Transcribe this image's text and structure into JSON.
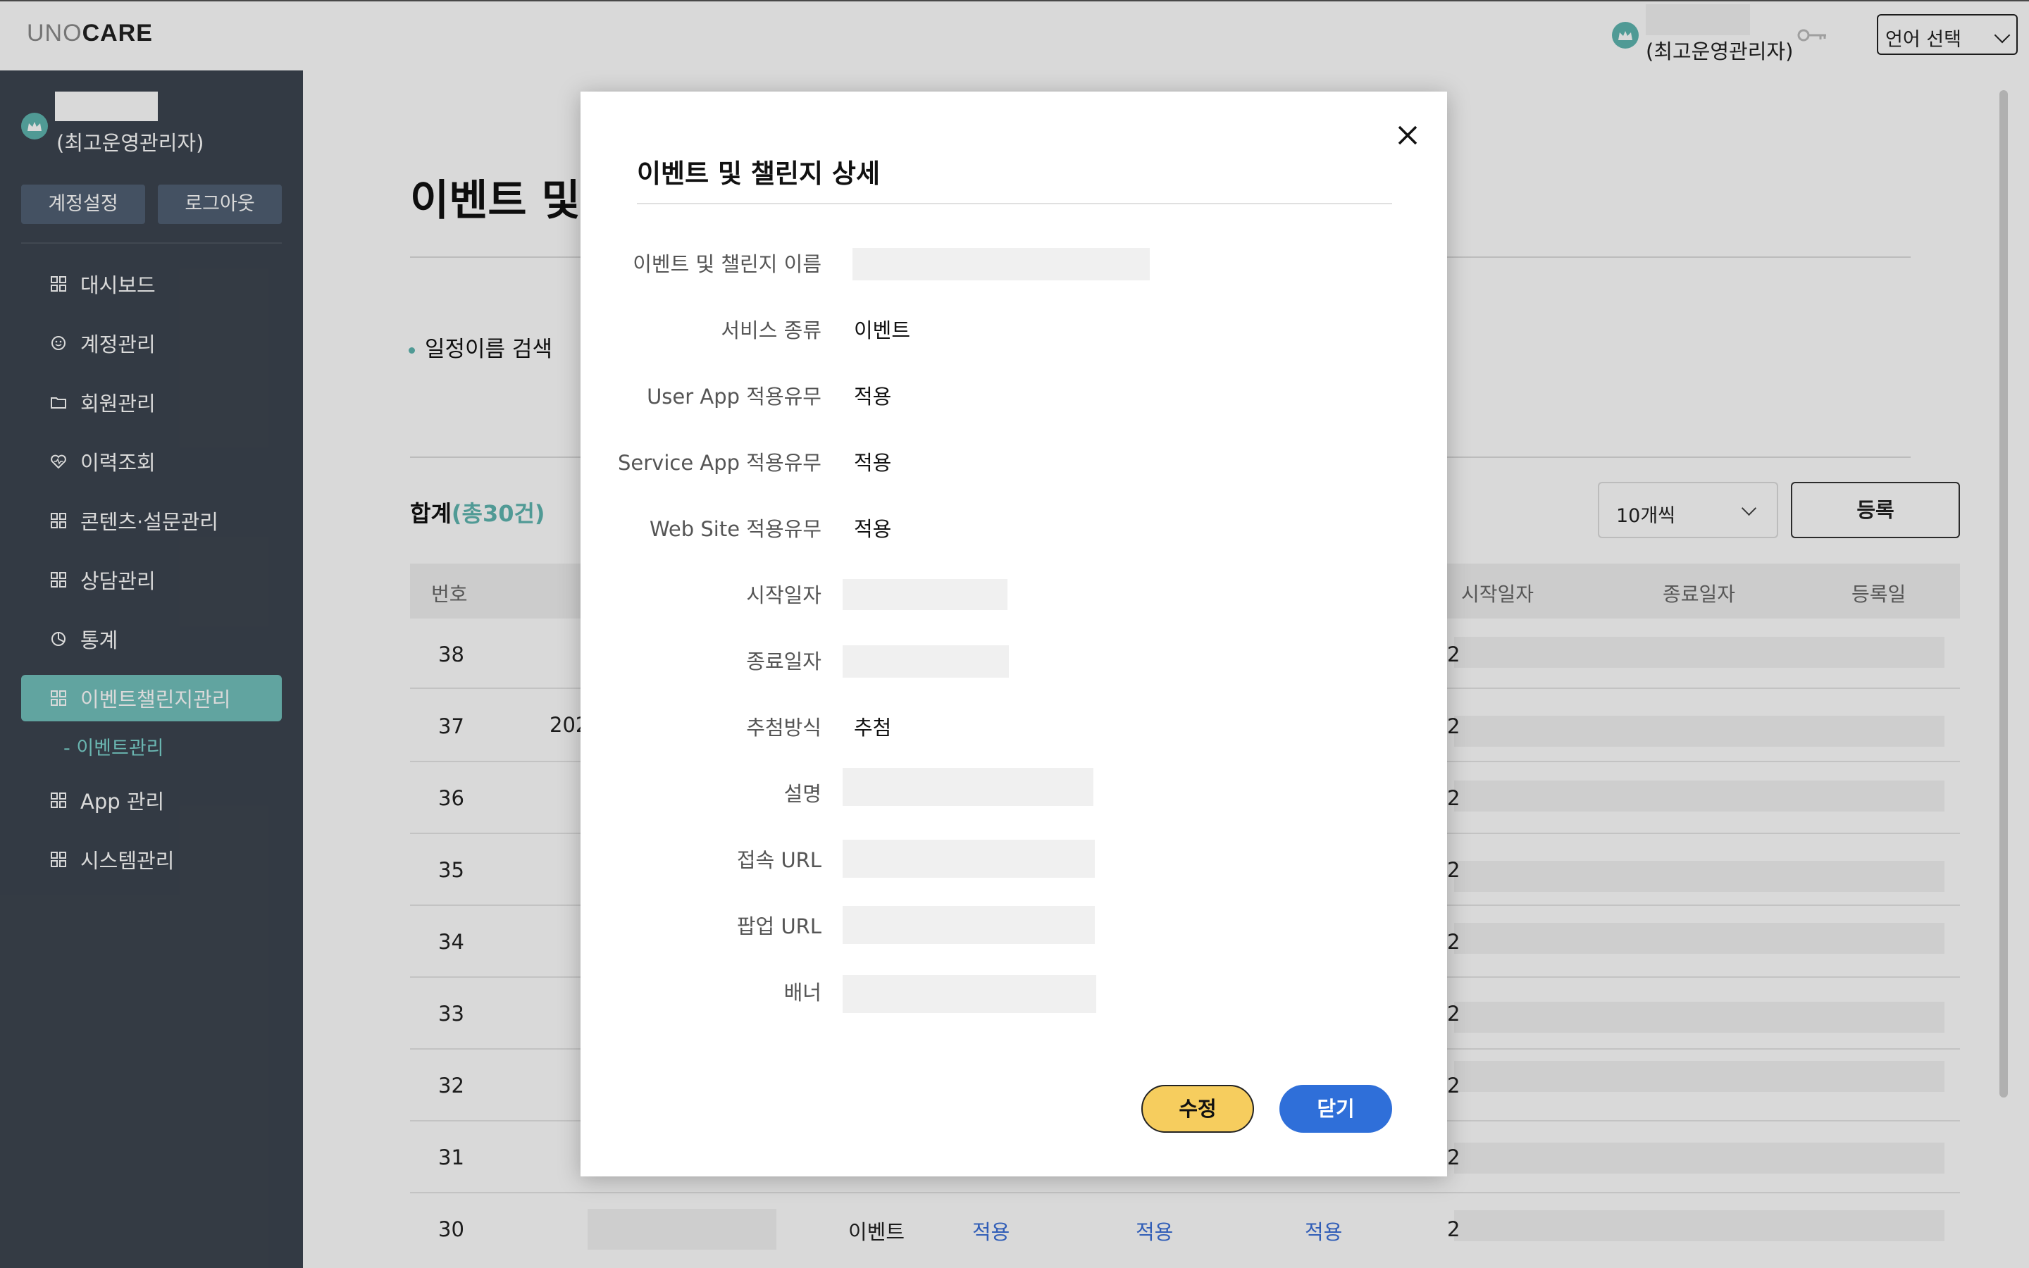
{
  "header": {
    "logo_uno": "UNO",
    "logo_care": "CARE",
    "user_role": "(최고운영관리자)",
    "language_select": "언어 선택"
  },
  "sidebar": {
    "user_role": "(최고운영관리자)",
    "account_settings": "계정설정",
    "logout": "로그아웃",
    "items": [
      {
        "label": "대시보드",
        "icon": "grid-icon"
      },
      {
        "label": "계정관리",
        "icon": "smile-icon"
      },
      {
        "label": "회원관리",
        "icon": "folder-icon"
      },
      {
        "label": "이력조회",
        "icon": "heart-icon"
      },
      {
        "label": "콘텐츠·설문관리",
        "icon": "grid-icon"
      },
      {
        "label": "상담관리",
        "icon": "grid-icon"
      },
      {
        "label": "통계",
        "icon": "chart-icon"
      },
      {
        "label": "이벤트챌린지관리",
        "icon": "grid-icon",
        "active": true
      },
      {
        "label": "App 관리",
        "icon": "grid-icon"
      },
      {
        "label": "시스템관리",
        "icon": "grid-icon"
      }
    ],
    "sub_item": "- 이벤트관리"
  },
  "main": {
    "title": "이벤트 및",
    "search_label": "일정이름 검색",
    "total_label": "합계",
    "total_count": "(총30건)",
    "page_size": "10개씩",
    "register": "등록",
    "columns": {
      "num": "번호",
      "start": "시작일자",
      "end": "종료일자",
      "reg": "등록일"
    },
    "rows": [
      "38",
      "37",
      "36",
      "35",
      "34",
      "33",
      "32",
      "31",
      "30"
    ],
    "row37_date": "202",
    "row_lead": "2",
    "row30": {
      "type": "이벤트",
      "user_app": "적용",
      "service_app": "적용",
      "web_site": "적용"
    }
  },
  "modal": {
    "title": "이벤트 및 챌린지 상세",
    "fields": {
      "name_label": "이벤트 및 챌린지 이름",
      "service_type_label": "서비스 종류",
      "service_type_value": "이벤트",
      "user_app_label": "User App 적용유무",
      "user_app_value": "적용",
      "service_app_label": "Service App 적용유무",
      "service_app_value": "적용",
      "web_site_label": "Web Site 적용유무",
      "web_site_value": "적용",
      "start_label": "시작일자",
      "end_label": "종료일자",
      "draw_label": "추첨방식",
      "draw_value": "추첨",
      "desc_label": "설명",
      "url_label": "접속 URL",
      "popup_url_label": "팝업 URL",
      "banner_label": "배너"
    },
    "edit_button": "수정",
    "close_button": "닫기"
  }
}
